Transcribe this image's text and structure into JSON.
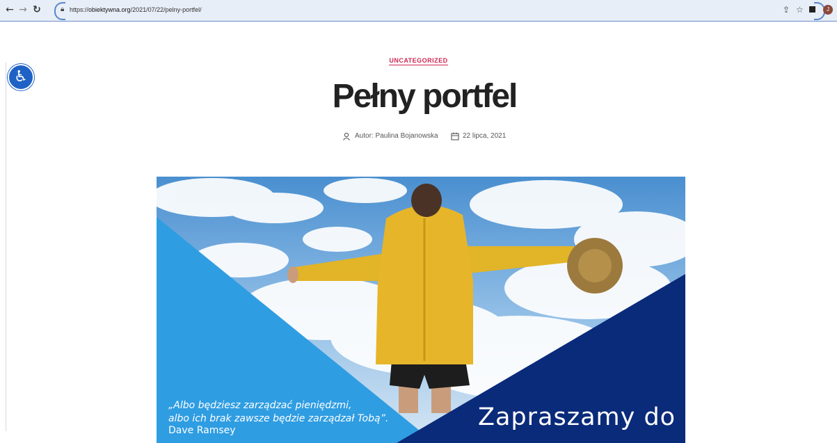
{
  "browser": {
    "url_prefix": "https://",
    "url_domain": "obiektywna.org",
    "url_path": "/2021/07/22/pelny-portfel/",
    "avatar_letter": "J"
  },
  "post": {
    "category": "UNCATEGORIZED",
    "title": "Pełny portfel",
    "author": "Autor: Paulina Bojanowska",
    "date": "22 lipca, 2021"
  },
  "hero": {
    "quote_line1": "„Albo będziesz zarządzać pieniędzmi,",
    "quote_line2": "albo ich brak zawsze będzie zarządzał Tobą”.",
    "quote_author": "Dave Ramsey",
    "invite_text": "Zapraszamy do"
  },
  "colors": {
    "accent": "#cd2653",
    "light_blue": "#2f9de2",
    "dark_blue": "#0a2a7a",
    "a11y_button": "#1f62c5"
  }
}
